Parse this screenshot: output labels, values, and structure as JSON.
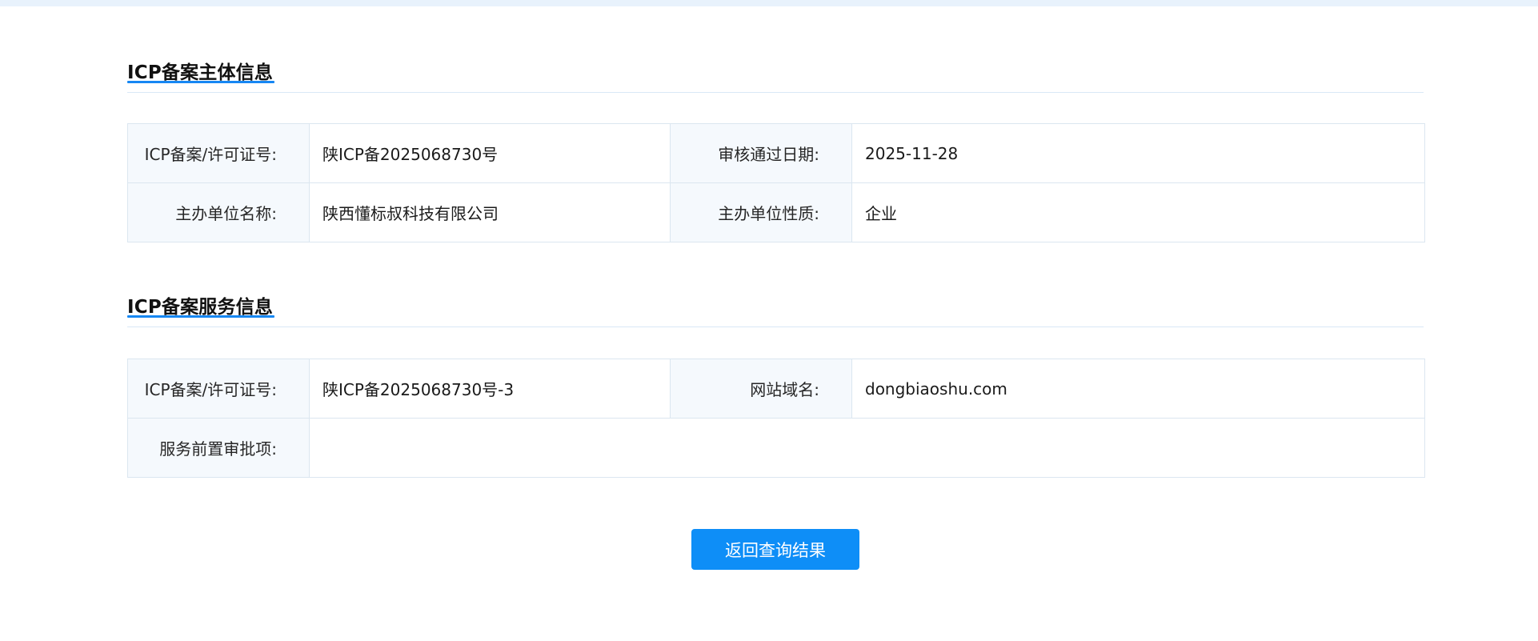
{
  "colors": {
    "accent": "#1687f3",
    "button": "#0e8ef7",
    "label_bg": "#f5f9fd",
    "border": "#dbe6f0"
  },
  "section_subject": {
    "title": "ICP备案主体信息",
    "rows": [
      {
        "label1": "ICP备案/许可证号:",
        "value1": "陕ICP备2025068730号",
        "label2": "审核通过日期:",
        "value2": "2025-11-28"
      },
      {
        "label1": "主办单位名称:",
        "value1": "陕西懂标叔科技有限公司",
        "label2": "主办单位性质:",
        "value2": "企业"
      }
    ]
  },
  "section_service": {
    "title": "ICP备案服务信息",
    "row1": {
      "label1": "ICP备案/许可证号:",
      "value1": "陕ICP备2025068730号-3",
      "label2": "网站域名:",
      "value2": "dongbiaoshu.com"
    },
    "row2": {
      "label": "服务前置审批项:",
      "value": ""
    }
  },
  "actions": {
    "return_label": "返回查询结果"
  }
}
